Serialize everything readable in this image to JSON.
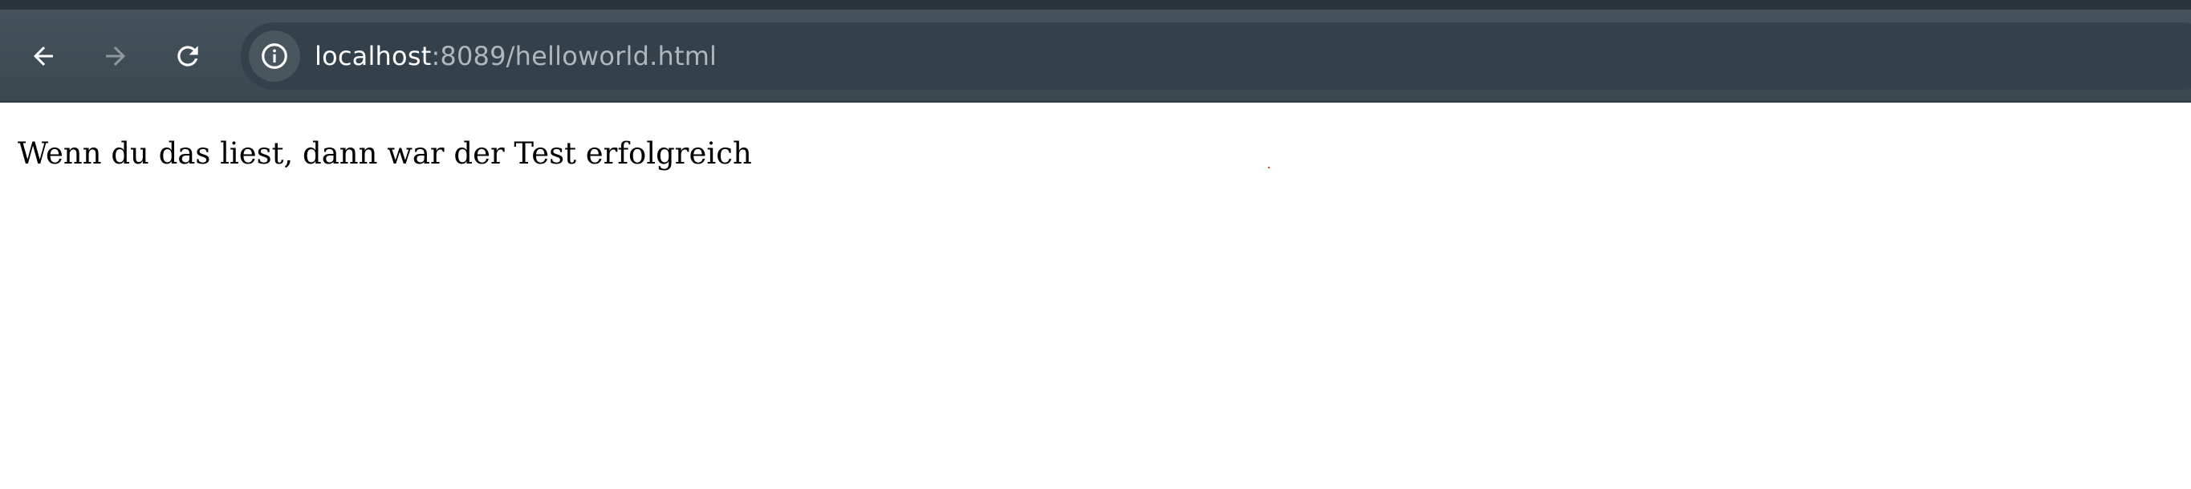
{
  "browser": {
    "url_host": "localhost",
    "url_rest": ":8089/helloworld.html",
    "nav": {
      "back_icon": "arrow-left-icon",
      "forward_icon": "arrow-right-icon",
      "reload_icon": "reload-icon",
      "site_info_icon": "info-circle-icon"
    },
    "colors": {
      "toolbar": "#3b4850",
      "omnibox": "#35414a",
      "icon_active": "#ffffff",
      "icon_disabled": "#8d979d"
    }
  },
  "page": {
    "text": "Wenn du das liest, dann war der Test erfolgreich",
    "background": "#ffffff"
  }
}
